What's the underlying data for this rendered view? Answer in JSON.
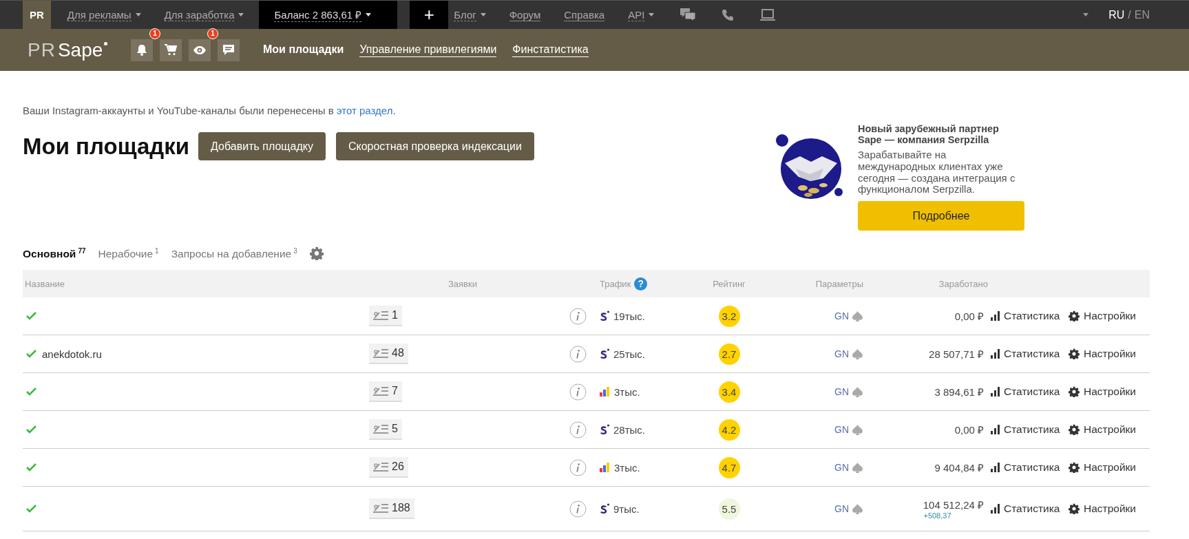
{
  "top_bar": {
    "home_tab": "PR",
    "menus_left": [
      {
        "label": "Для рекламы",
        "dropdown": true
      },
      {
        "label": "Для заработка",
        "dropdown": true
      }
    ],
    "balance": {
      "label": "Баланс 2 863,61 ₽",
      "dropdown": true
    },
    "add_button": "+",
    "menus_right": [
      {
        "label": "Блог",
        "dropdown": true
      },
      {
        "label": "Форум",
        "dropdown": false
      },
      {
        "label": "Справка",
        "dropdown": false
      },
      {
        "label": "API",
        "dropdown": true
      }
    ],
    "tools": [
      {
        "kind": "chats"
      },
      {
        "kind": "phone"
      },
      {
        "kind": "laptop"
      }
    ],
    "languages": [
      {
        "label": "RU",
        "selected": true
      },
      {
        "label": "EN",
        "selected": false
      }
    ],
    "language_separator": "/"
  },
  "header": {
    "logo": {
      "prefix": "PR",
      "name": "Sape"
    },
    "icons": [
      {
        "kind": "bell",
        "badge": "1"
      },
      {
        "kind": "cart"
      },
      {
        "kind": "eye",
        "badge": "1"
      },
      {
        "kind": "chat"
      }
    ],
    "nav": [
      {
        "label": "Мои площадки",
        "selected": true
      },
      {
        "label": "Управление привилегиями",
        "selected": false
      },
      {
        "label": "Финстатистика",
        "selected": false
      }
    ]
  },
  "notice": {
    "text": "Ваши Instagram-аккаунты и YouTube-каналы были перенесены в ",
    "link": "этот раздел",
    "end": "."
  },
  "page_title": "Мои площадки",
  "actions": [
    "Добавить площадку",
    "Скоростная проверка индексации"
  ],
  "promo": {
    "kind": "picture",
    "title": "Новый зарубежный партнер Sape — компания Serpzilla",
    "text": "Зарабатывайте на международных клиентах уже сегодня — создана интеграция с функционалом Serpzilla.",
    "button": "Подробнее"
  },
  "tabs": [
    {
      "label": "Основной",
      "count": "77",
      "selected": true
    },
    {
      "label": "Нерабочие",
      "count": "1",
      "selected": false
    },
    {
      "label": "Запросы на добавление",
      "count": "3",
      "selected": false
    }
  ],
  "table": {
    "columns": [
      "Название",
      "Заявки",
      "Трафик",
      "Рейтинг",
      "Параметры",
      "Заработано"
    ],
    "traffic_help": "?",
    "rows": [
      {
        "verified": true,
        "requests": "1",
        "kind": "sape",
        "traffic": "19тыс.",
        "rating": "3.2",
        "color": "#ffd200",
        "params": "GN",
        "earned": "0,00 ₽",
        "stats": "Статистика",
        "settings": "Настройки"
      },
      {
        "verified": true,
        "name": "anekdotok.ru",
        "requests": "48",
        "kind": "sape",
        "traffic": "25тыс.",
        "rating": "2.7",
        "color": "#ffd200",
        "params": "GN",
        "earned": "28 507,71 ₽",
        "stats": "Статистика",
        "settings": "Настройки"
      },
      {
        "verified": true,
        "requests": "7",
        "kind": "bars",
        "traffic": "3тыс.",
        "rating": "3.4",
        "color": "#ffd200",
        "params": "GN",
        "earned": "3 894,61 ₽",
        "stats": "Статистика",
        "settings": "Настройки"
      },
      {
        "verified": true,
        "requests": "5",
        "kind": "sape",
        "traffic": "28тыс.",
        "rating": "4.2",
        "color": "#ffd200",
        "params": "GN",
        "earned": "0,00 ₽",
        "stats": "Статистика",
        "settings": "Настройки"
      },
      {
        "verified": true,
        "requests": "26",
        "kind": "bars",
        "traffic": "3тыс.",
        "rating": "4.7",
        "color": "#ffd200",
        "params": "GN",
        "earned": "9 404,84 ₽",
        "stats": "Статистика",
        "settings": "Настройки"
      },
      {
        "verified": true,
        "requests": "188",
        "kind": "sape",
        "traffic": "9тыс.",
        "rating": "5.5",
        "color": "#eef7dc",
        "params": "GN",
        "earned": "104 512,24 ₽",
        "earned_delta": "+508,37",
        "stats": "Статистика",
        "settings": "Настройки"
      }
    ]
  }
}
